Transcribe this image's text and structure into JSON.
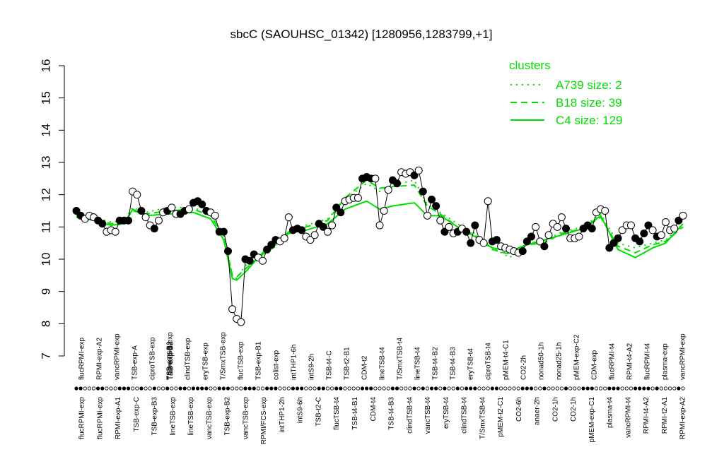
{
  "chart_data": {
    "type": "line",
    "title": "sbcC (SAOUHSC_01342) [1280956,1283799,+1]",
    "xlabel": "",
    "ylabel": "",
    "ylim": [
      7,
      16
    ],
    "yticks": [
      7,
      8,
      9,
      10,
      11,
      12,
      13,
      14,
      15,
      16
    ],
    "grid": false,
    "legend": {
      "title": "clusters",
      "position": "top-right",
      "entries": [
        {
          "label": "A739 size: 2",
          "style": "dotted"
        },
        {
          "label": "B18 size: 39",
          "style": "dashed"
        },
        {
          "label": "C4 size: 129",
          "style": "solid"
        }
      ]
    },
    "colors": {
      "cluster_line": "#00dd00",
      "point_fill_member": "#000000",
      "point_fill_other": "#ffffff",
      "axis": "#000000"
    },
    "x_labels_top": [
      "flucRPMI-exp",
      "RPMI-exp-A2",
      "vancRPMI-exp",
      "TSB-exp-A",
      "ciproTSB-exp",
      "T/SmxTSB-exp",
      "clindTSB-exp",
      "eryTSB-exp",
      "T/SmxTSB-exp",
      "flucTSB-exp",
      "TSB-exp-B1",
      "colist-exp",
      "intTHP1-6h",
      "intS9-2h",
      "TSB-t4-C",
      "TSB-t2-B1",
      "CDM-t2",
      "lineTSB-t4",
      "T/SmxTSB-t4",
      "lineTSB-t4",
      "TSB-t4-B2",
      "TSB-t4-B3",
      "eryTSB-t4",
      "ciproTSB-t4",
      "pMEM-t4-C1",
      "CO2-2h",
      "nonad50-1h",
      "nonad25-1h",
      "pMEM-exp-C2",
      "CDM-exp",
      "flucRPMI-t4",
      "RPMI-t4-A2",
      "flucRPMI-t4",
      "plasma-exp",
      "vancRPMI-exp"
    ],
    "x_labels_bottom": [
      "flucRPMI-exp",
      "flucRPMI-exp",
      "RPMI-exp-A1",
      "TSB-exp-C",
      "TSB-exp-B3",
      "lineTSB-exp",
      "lineTSB-exp",
      "vancTSB-exp",
      "TSB-exp-B2",
      "vancTSB-exp",
      "RPMI/FCS-exp",
      "intTHP1-2h",
      "intS9-6h",
      "TSB-t2-C",
      "flucTSB-t4",
      "TSB-t4-B1",
      "CDM-t4",
      "TSB-t4-B3",
      "clindTSB-t4",
      "vancTSB-t4",
      "eryTSB-t4",
      "clindTSB-t4",
      "T/SmxTSB-t4",
      "pMEM-t2-C1",
      "CO2-6h",
      "anaer-2h",
      "CO2-1h",
      "CO2-1h",
      "pMEM-exp-C1",
      "plasma-t4",
      "vancRPMI-t4",
      "RPMI-t4-A2",
      "RPMI-t2-A1",
      "RPMI-exp-A2"
    ],
    "x_labels_overlap": [
      "TSB-exp-B2",
      "TSB-exp-B2"
    ],
    "points": [
      {
        "x": 1,
        "y": 11.5,
        "member": true
      },
      {
        "x": 2,
        "y": 11.35,
        "member": true
      },
      {
        "x": 3,
        "y": 11.25,
        "member": false
      },
      {
        "x": 4,
        "y": 11.35,
        "member": false
      },
      {
        "x": 5,
        "y": 11.3,
        "member": false
      },
      {
        "x": 6,
        "y": 11.2,
        "member": true
      },
      {
        "x": 7,
        "y": 11.1,
        "member": true
      },
      {
        "x": 8,
        "y": 10.85,
        "member": false
      },
      {
        "x": 9,
        "y": 10.9,
        "member": false
      },
      {
        "x": 10,
        "y": 10.85,
        "member": false
      },
      {
        "x": 11,
        "y": 11.2,
        "member": true
      },
      {
        "x": 12,
        "y": 11.2,
        "member": true
      },
      {
        "x": 13,
        "y": 11.2,
        "member": true
      },
      {
        "x": 14,
        "y": 12.1,
        "member": false
      },
      {
        "x": 15,
        "y": 12.0,
        "member": false
      },
      {
        "x": 16,
        "y": 11.5,
        "member": true
      },
      {
        "x": 17,
        "y": 11.3,
        "member": false
      },
      {
        "x": 18,
        "y": 11.05,
        "member": false
      },
      {
        "x": 19,
        "y": 10.95,
        "member": true
      },
      {
        "x": 20,
        "y": 11.2,
        "member": false
      },
      {
        "x": 21,
        "y": 11.45,
        "member": false
      },
      {
        "x": 22,
        "y": 11.5,
        "member": true
      },
      {
        "x": 23,
        "y": 11.6,
        "member": false
      },
      {
        "x": 24,
        "y": 11.4,
        "member": false
      },
      {
        "x": 25,
        "y": 11.4,
        "member": true
      },
      {
        "x": 26,
        "y": 11.5,
        "member": true
      },
      {
        "x": 27,
        "y": 11.55,
        "member": false
      },
      {
        "x": 28,
        "y": 11.75,
        "member": true
      },
      {
        "x": 29,
        "y": 11.8,
        "member": true
      },
      {
        "x": 30,
        "y": 11.7,
        "member": true
      },
      {
        "x": 31,
        "y": 11.5,
        "member": true
      },
      {
        "x": 32,
        "y": 11.45,
        "member": false
      },
      {
        "x": 33,
        "y": 11.35,
        "member": false
      },
      {
        "x": 34,
        "y": 10.85,
        "member": true
      },
      {
        "x": 35,
        "y": 10.85,
        "member": true
      },
      {
        "x": 36,
        "y": 10.25,
        "member": true
      },
      {
        "x": 37,
        "y": 8.45,
        "member": false
      },
      {
        "x": 38,
        "y": 8.15,
        "member": false
      },
      {
        "x": 39,
        "y": 8.05,
        "member": false
      },
      {
        "x": 40,
        "y": 10.0,
        "member": true
      },
      {
        "x": 41,
        "y": 9.95,
        "member": true
      },
      {
        "x": 42,
        "y": 10.15,
        "member": true
      },
      {
        "x": 43,
        "y": 10.05,
        "member": false
      },
      {
        "x": 44,
        "y": 9.95,
        "member": false
      },
      {
        "x": 45,
        "y": 10.3,
        "member": true
      },
      {
        "x": 46,
        "y": 10.45,
        "member": true
      },
      {
        "x": 47,
        "y": 10.6,
        "member": true
      },
      {
        "x": 48,
        "y": 10.55,
        "member": false
      },
      {
        "x": 49,
        "y": 10.65,
        "member": false
      },
      {
        "x": 50,
        "y": 11.3,
        "member": false
      },
      {
        "x": 51,
        "y": 10.9,
        "member": true
      },
      {
        "x": 52,
        "y": 10.95,
        "member": true
      },
      {
        "x": 53,
        "y": 10.9,
        "member": true
      },
      {
        "x": 54,
        "y": 10.7,
        "member": false
      },
      {
        "x": 55,
        "y": 10.6,
        "member": false
      },
      {
        "x": 56,
        "y": 10.75,
        "member": false
      },
      {
        "x": 57,
        "y": 11.1,
        "member": true
      },
      {
        "x": 58,
        "y": 11.0,
        "member": true
      },
      {
        "x": 59,
        "y": 10.85,
        "member": false
      },
      {
        "x": 60,
        "y": 11.05,
        "member": false
      },
      {
        "x": 61,
        "y": 11.6,
        "member": true
      },
      {
        "x": 62,
        "y": 11.45,
        "member": true
      },
      {
        "x": 63,
        "y": 11.8,
        "member": false
      },
      {
        "x": 64,
        "y": 11.85,
        "member": false
      },
      {
        "x": 65,
        "y": 11.9,
        "member": false
      },
      {
        "x": 66,
        "y": 11.9,
        "member": false
      },
      {
        "x": 67,
        "y": 12.5,
        "member": true
      },
      {
        "x": 68,
        "y": 12.55,
        "member": true
      },
      {
        "x": 69,
        "y": 12.5,
        "member": true
      },
      {
        "x": 70,
        "y": 12.5,
        "member": false
      },
      {
        "x": 71,
        "y": 11.05,
        "member": false
      },
      {
        "x": 72,
        "y": 11.5,
        "member": false
      },
      {
        "x": 73,
        "y": 12.15,
        "member": false
      },
      {
        "x": 74,
        "y": 12.45,
        "member": true
      },
      {
        "x": 75,
        "y": 12.35,
        "member": true
      },
      {
        "x": 76,
        "y": 12.7,
        "member": false
      },
      {
        "x": 77,
        "y": 12.65,
        "member": false
      },
      {
        "x": 78,
        "y": 12.7,
        "member": false
      },
      {
        "x": 79,
        "y": 12.6,
        "member": true
      },
      {
        "x": 80,
        "y": 12.75,
        "member": false
      },
      {
        "x": 81,
        "y": 12.1,
        "member": true
      },
      {
        "x": 82,
        "y": 11.35,
        "member": false
      },
      {
        "x": 83,
        "y": 11.85,
        "member": true
      },
      {
        "x": 84,
        "y": 11.65,
        "member": true
      },
      {
        "x": 85,
        "y": 11.2,
        "member": false
      },
      {
        "x": 86,
        "y": 10.85,
        "member": true
      },
      {
        "x": 87,
        "y": 11.0,
        "member": false
      },
      {
        "x": 88,
        "y": 10.8,
        "member": false
      },
      {
        "x": 89,
        "y": 10.85,
        "member": true
      },
      {
        "x": 90,
        "y": 10.95,
        "member": false
      },
      {
        "x": 91,
        "y": 10.85,
        "member": true
      },
      {
        "x": 92,
        "y": 10.5,
        "member": true
      },
      {
        "x": 93,
        "y": 11.05,
        "member": true
      },
      {
        "x": 94,
        "y": 10.6,
        "member": false
      },
      {
        "x": 95,
        "y": 10.5,
        "member": false
      },
      {
        "x": 96,
        "y": 11.8,
        "member": false
      },
      {
        "x": 97,
        "y": 10.55,
        "member": true
      },
      {
        "x": 98,
        "y": 10.6,
        "member": true
      },
      {
        "x": 99,
        "y": 10.4,
        "member": false
      },
      {
        "x": 100,
        "y": 10.35,
        "member": false
      },
      {
        "x": 101,
        "y": 10.3,
        "member": false
      },
      {
        "x": 102,
        "y": 10.25,
        "member": false
      },
      {
        "x": 103,
        "y": 10.2,
        "member": false
      },
      {
        "x": 104,
        "y": 10.25,
        "member": true
      },
      {
        "x": 105,
        "y": 10.55,
        "member": true
      },
      {
        "x": 106,
        "y": 10.7,
        "member": true
      },
      {
        "x": 107,
        "y": 11.0,
        "member": false
      },
      {
        "x": 108,
        "y": 10.55,
        "member": false
      },
      {
        "x": 109,
        "y": 10.4,
        "member": true
      },
      {
        "x": 110,
        "y": 10.75,
        "member": false
      },
      {
        "x": 111,
        "y": 11.1,
        "member": false
      },
      {
        "x": 112,
        "y": 11.0,
        "member": false
      },
      {
        "x": 113,
        "y": 11.3,
        "member": false
      },
      {
        "x": 114,
        "y": 10.95,
        "member": true
      },
      {
        "x": 115,
        "y": 10.65,
        "member": false
      },
      {
        "x": 116,
        "y": 10.65,
        "member": false
      },
      {
        "x": 117,
        "y": 10.7,
        "member": false
      },
      {
        "x": 118,
        "y": 10.95,
        "member": true
      },
      {
        "x": 119,
        "y": 11.05,
        "member": true
      },
      {
        "x": 120,
        "y": 10.95,
        "member": true
      },
      {
        "x": 121,
        "y": 11.45,
        "member": false
      },
      {
        "x": 122,
        "y": 11.55,
        "member": false
      },
      {
        "x": 123,
        "y": 11.5,
        "member": false
      },
      {
        "x": 124,
        "y": 10.35,
        "member": true
      },
      {
        "x": 125,
        "y": 10.5,
        "member": true
      },
      {
        "x": 126,
        "y": 10.65,
        "member": true
      },
      {
        "x": 127,
        "y": 10.9,
        "member": false
      },
      {
        "x": 128,
        "y": 11.05,
        "member": false
      },
      {
        "x": 129,
        "y": 11.05,
        "member": false
      },
      {
        "x": 130,
        "y": 10.65,
        "member": true
      },
      {
        "x": 131,
        "y": 10.55,
        "member": true
      },
      {
        "x": 132,
        "y": 10.8,
        "member": true
      },
      {
        "x": 133,
        "y": 11.05,
        "member": true
      },
      {
        "x": 134,
        "y": 10.9,
        "member": false
      },
      {
        "x": 135,
        "y": 10.7,
        "member": true
      },
      {
        "x": 136,
        "y": 10.75,
        "member": false
      },
      {
        "x": 137,
        "y": 11.15,
        "member": false
      },
      {
        "x": 138,
        "y": 10.9,
        "member": false
      },
      {
        "x": 139,
        "y": 10.95,
        "member": false
      },
      {
        "x": 140,
        "y": 11.2,
        "member": true
      },
      {
        "x": 141,
        "y": 11.35,
        "member": false
      }
    ],
    "series": [
      {
        "name": "C4 size: 129",
        "style": "solid",
        "x": [
          1,
          5,
          9,
          12,
          14,
          17,
          22,
          28,
          32,
          35,
          37,
          38,
          40,
          44,
          47,
          50,
          54,
          59,
          63,
          68,
          71,
          74,
          79,
          82,
          85,
          89,
          93,
          97,
          101,
          105,
          109,
          113,
          118,
          122,
          126,
          130,
          134,
          137,
          141
        ],
        "values": [
          11.3,
          11.2,
          11.05,
          11.1,
          11.55,
          11.35,
          11.4,
          11.45,
          11.25,
          10.6,
          9.4,
          9.35,
          9.6,
          10.2,
          10.45,
          10.85,
          10.9,
          11.1,
          11.55,
          11.8,
          11.55,
          11.65,
          11.75,
          11.35,
          11.35,
          11.0,
          10.7,
          10.35,
          10.25,
          10.45,
          10.6,
          10.75,
          10.95,
          11.35,
          10.3,
          10.05,
          10.35,
          10.5,
          11.1
        ]
      },
      {
        "name": "B18 size: 39",
        "style": "dashed",
        "x": [
          1,
          5,
          9,
          12,
          14,
          17,
          22,
          28,
          32,
          35,
          37,
          38,
          40,
          44,
          47,
          50,
          54,
          59,
          63,
          68,
          71,
          74,
          79,
          82,
          85,
          89,
          93,
          97,
          101,
          105,
          109,
          113,
          118,
          122,
          126,
          130,
          134,
          137,
          141
        ],
        "values": [
          11.35,
          11.25,
          11.1,
          11.15,
          11.5,
          11.4,
          11.5,
          11.55,
          11.35,
          10.7,
          9.5,
          9.45,
          9.7,
          10.15,
          10.4,
          10.8,
          11.0,
          11.2,
          11.9,
          12.45,
          12.2,
          12.25,
          12.3,
          11.65,
          11.4,
          11.0,
          10.75,
          10.3,
          10.15,
          10.45,
          10.5,
          10.8,
          10.95,
          11.3,
          10.4,
          10.2,
          10.45,
          10.55,
          11.0
        ]
      },
      {
        "name": "A739 size: 2",
        "style": "dotted",
        "x": [
          1,
          5,
          9,
          12,
          14,
          17,
          22,
          28,
          32,
          35,
          37,
          38,
          40,
          44,
          47,
          50,
          54,
          59,
          63,
          68,
          71,
          74,
          79,
          82,
          85,
          89,
          93,
          97,
          101,
          105,
          109,
          113,
          118,
          122,
          126,
          130,
          134,
          137,
          141
        ],
        "values": [
          11.4,
          11.3,
          11.15,
          11.2,
          11.6,
          11.45,
          11.6,
          11.6,
          11.4,
          10.75,
          9.5,
          9.4,
          9.8,
          10.25,
          10.45,
          10.85,
          11.05,
          11.25,
          11.85,
          12.35,
          12.1,
          12.3,
          12.45,
          11.7,
          11.45,
          11.1,
          10.8,
          10.35,
          10.05,
          10.5,
          10.55,
          10.85,
          11.0,
          11.4,
          10.5,
          10.35,
          10.5,
          10.6,
          11.05
        ]
      }
    ]
  }
}
